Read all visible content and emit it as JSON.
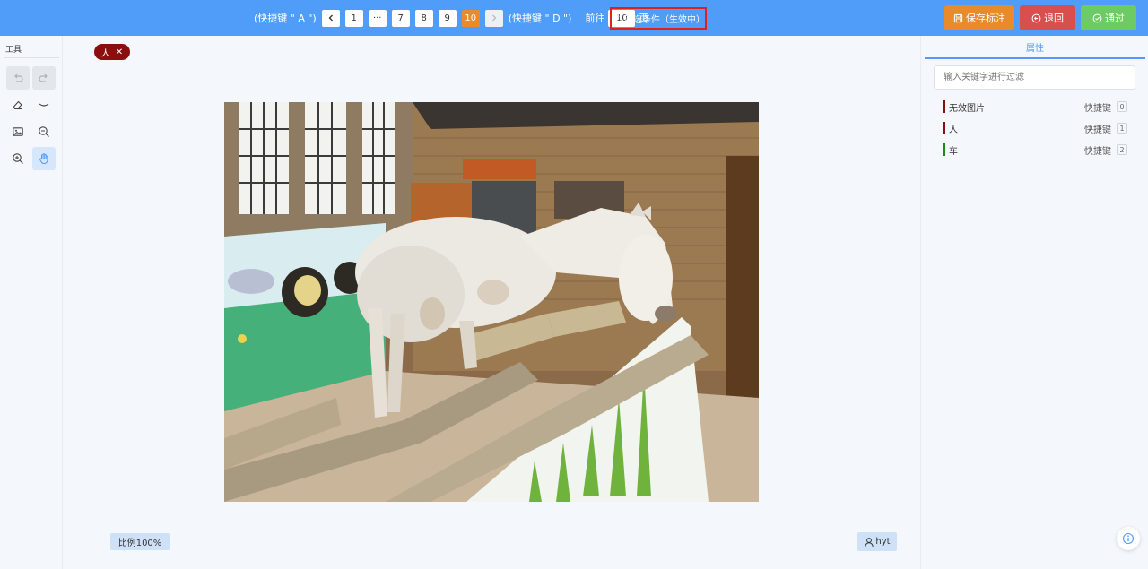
{
  "topbar": {
    "prev_hint": "(快捷键 \" A \")",
    "next_hint": "(快捷键 \" D \")",
    "pages": [
      {
        "label": "1",
        "state": "normal"
      },
      {
        "label": "···",
        "state": "normal"
      },
      {
        "label": "7",
        "state": "normal"
      },
      {
        "label": "8",
        "state": "normal"
      },
      {
        "label": "9",
        "state": "normal"
      },
      {
        "label": "10",
        "state": "active"
      }
    ],
    "goto_label": "前往",
    "goto_value": "10",
    "goto_suffix": "页",
    "filter_label": "筛选条件（生效中）",
    "save_label": "保存标注",
    "back_label": "退回",
    "pass_label": "通过"
  },
  "tools": {
    "title": "工具",
    "items": [
      {
        "name": "undo-icon",
        "state": "disabled"
      },
      {
        "name": "redo-icon",
        "state": "disabled"
      },
      {
        "name": "eraser-icon",
        "state": "normal"
      },
      {
        "name": "eye-closed-icon",
        "state": "normal"
      },
      {
        "name": "image-icon",
        "state": "normal"
      },
      {
        "name": "zoom-out-icon",
        "state": "normal"
      },
      {
        "name": "zoom-in-icon",
        "state": "normal"
      },
      {
        "name": "hand-icon",
        "state": "active"
      }
    ]
  },
  "canvas": {
    "active_label": "人",
    "scale_text": "比例100%",
    "user_name": "hyt"
  },
  "right_panel": {
    "tab_label": "属性",
    "filter_placeholder": "输入关键字进行过滤",
    "shortcut_label": "快捷键",
    "attributes": [
      {
        "name": "无效图片",
        "key": "0",
        "color": "#8b0e0e"
      },
      {
        "name": "人",
        "key": "1",
        "color": "#8b0e0e"
      },
      {
        "name": "车",
        "key": "2",
        "color": "#1a8a1a"
      }
    ]
  },
  "colors": {
    "topbar": "#4f9cf9",
    "save": "#e98b2a",
    "back": "#d94f4f",
    "pass": "#6ccb63",
    "page_active": "#e98b2a",
    "filter_border": "#e0201d"
  }
}
